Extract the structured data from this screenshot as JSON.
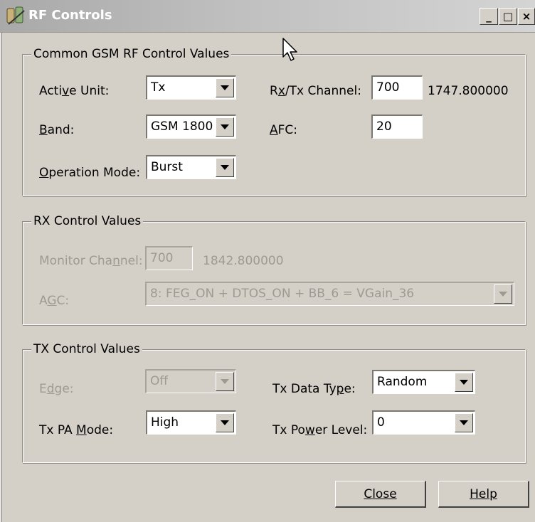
{
  "window": {
    "title": "RF Controls"
  },
  "titlebar": {
    "minimize": "_",
    "maximize": "□",
    "close": "×"
  },
  "common": {
    "legend": "Common GSM RF Control Values",
    "active_unit": {
      "label": "Active Unit:",
      "value": "Tx"
    },
    "band": {
      "label": "Band:",
      "value": "GSM 1800"
    },
    "operation_mode": {
      "label": "Operation Mode:",
      "value": "Burst"
    },
    "channel": {
      "label": "Rx/Tx Channel:",
      "value": "700",
      "frequency": "1747.800000"
    },
    "afc": {
      "label": "AFC:",
      "value": "20"
    }
  },
  "rx": {
    "legend": "RX Control Values",
    "monitor_channel": {
      "label": "Monitor Channel:",
      "value": "700",
      "frequency": "1842.800000"
    },
    "agc": {
      "label": "AGC:",
      "value": "8: FEG_ON + DTOS_ON + BB_6 = VGain_36"
    }
  },
  "tx": {
    "legend": "TX Control Values",
    "edge": {
      "label": "Edge:",
      "value": "Off"
    },
    "pa_mode": {
      "label": "Tx PA Mode:",
      "value": "High"
    },
    "data_type": {
      "label": "Tx Data Type:",
      "value": "Random"
    },
    "power_level": {
      "label": "Tx Power Level:",
      "value": "0"
    }
  },
  "buttons": {
    "close": "Close",
    "help": "Help"
  },
  "colors": {
    "disabled_text": "#9d9a93",
    "face": "#d4d0c8"
  }
}
